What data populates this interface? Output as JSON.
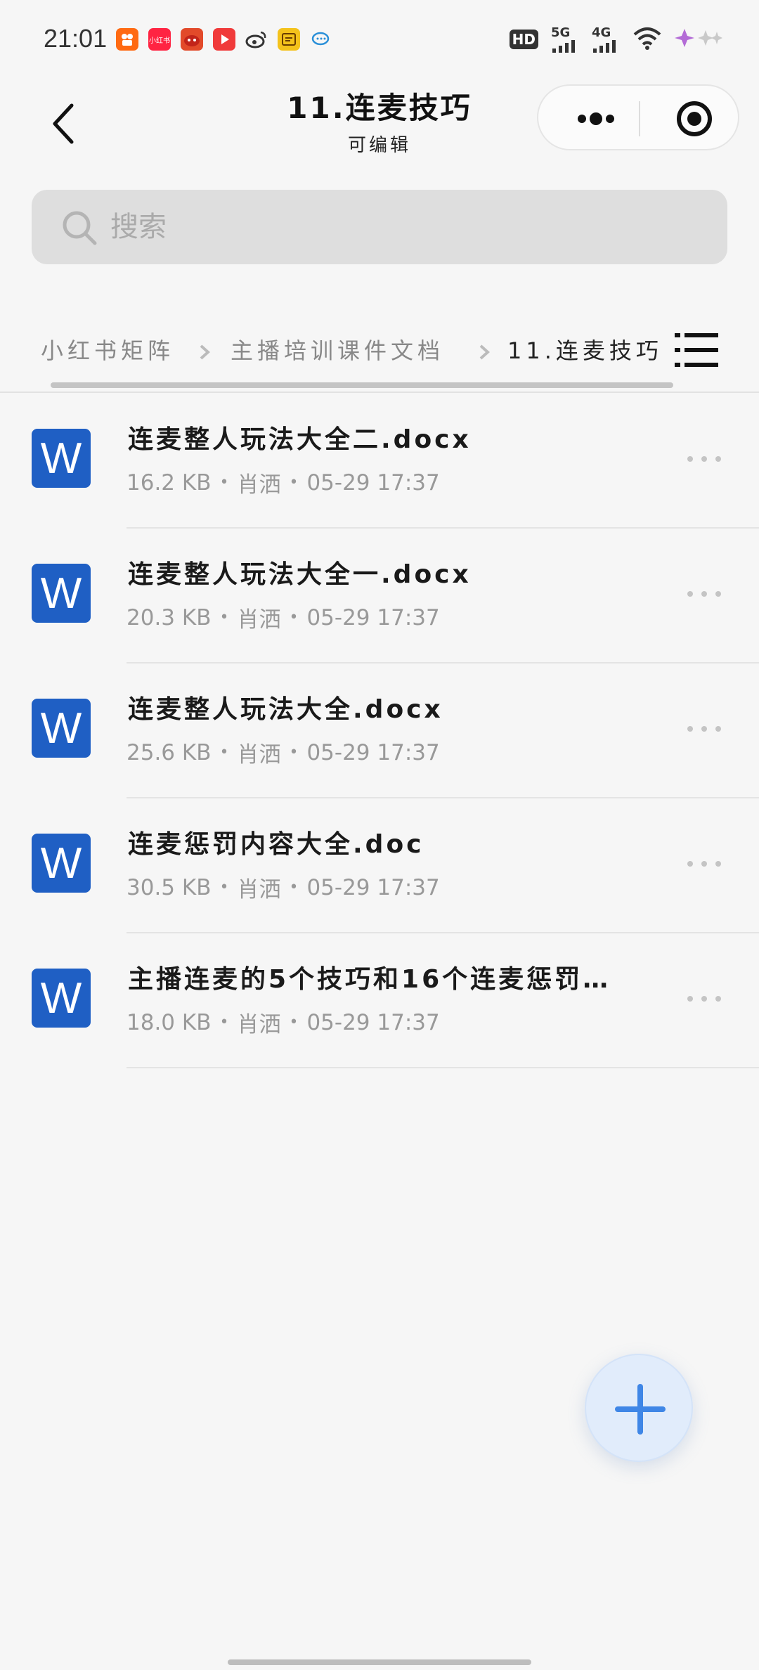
{
  "status_bar": {
    "time": "21:01",
    "app_icons": [
      {
        "name": "kuaishou-icon",
        "color": "#ff6a12",
        "glyph": ""
      },
      {
        "name": "xiaohongshu-icon",
        "color": "#ff2442",
        "glyph": "小红书"
      },
      {
        "name": "game-icon",
        "color": "#e24a2a",
        "glyph": ""
      },
      {
        "name": "video-app-icon",
        "color": "#f03a3a",
        "glyph": ""
      },
      {
        "name": "weibo-icon",
        "color": "#ffffff",
        "glyph": ""
      },
      {
        "name": "dictionary-app-icon",
        "color": "#f4c21b",
        "glyph": ""
      },
      {
        "name": "chat-bubble-icon",
        "color": "#ffffff",
        "glyph": ""
      }
    ],
    "network_hd": "HD",
    "network_5g": "5G",
    "network_4g": "4G",
    "sim_sub": "2"
  },
  "header": {
    "title": "11.连麦技巧",
    "subtitle": "可编辑"
  },
  "search": {
    "placeholder": "搜索"
  },
  "breadcrumb": {
    "items": [
      "小红书矩阵",
      "主播培训课件文档",
      "11.连麦技巧"
    ]
  },
  "files": [
    {
      "name": "连麦整人玩法大全二.docx",
      "size": "16.2 KB",
      "owner": "肖洒",
      "date": "05-29 17:37",
      "icon_label": "W"
    },
    {
      "name": "连麦整人玩法大全一.docx",
      "size": "20.3 KB",
      "owner": "肖洒",
      "date": "05-29 17:37",
      "icon_label": "W"
    },
    {
      "name": "连麦整人玩法大全.docx",
      "size": "25.6 KB",
      "owner": "肖洒",
      "date": "05-29 17:37",
      "icon_label": "W"
    },
    {
      "name": "连麦惩罚内容大全.doc",
      "size": "30.5 KB",
      "owner": "肖洒",
      "date": "05-29 17:37",
      "icon_label": "W"
    },
    {
      "name": "主播连麦的5个技巧和16个连麦惩罚…",
      "size": "18.0 KB",
      "owner": "肖洒",
      "date": "05-29 17:37",
      "icon_label": "W"
    }
  ],
  "meta_separator": "•",
  "colors": {
    "word_blue": "#1f5fc4",
    "fab_bg": "#e1ecfb",
    "fab_plus": "#3f86e6",
    "background": "#f6f6f6"
  }
}
